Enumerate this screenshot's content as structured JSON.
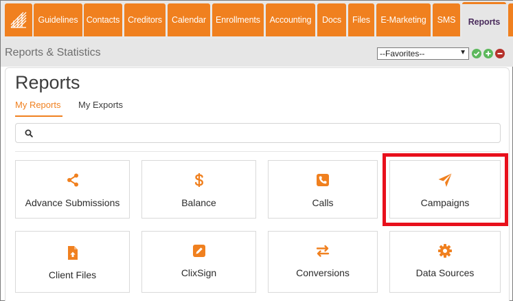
{
  "nav": {
    "tabs": [
      {
        "label": "Guidelines"
      },
      {
        "label": "Contacts"
      },
      {
        "label": "Creditors"
      },
      {
        "label": "Calendar"
      },
      {
        "label": "Enrollments"
      },
      {
        "label": "Accounting"
      },
      {
        "label": "Docs"
      },
      {
        "label": "Files"
      },
      {
        "label": "E-Marketing"
      },
      {
        "label": "SMS"
      },
      {
        "label": "Reports"
      }
    ],
    "active_tab": "Reports",
    "colors": {
      "tab": "#f0801f",
      "active_tab_text": "#4a2c5c"
    }
  },
  "subheader": {
    "title": "Reports & Statistics",
    "favorites": {
      "selected": "--Favorites--"
    },
    "buttons": [
      "check-icon",
      "plus-icon",
      "minus-icon"
    ]
  },
  "main": {
    "title": "Reports",
    "subtabs": [
      {
        "label": "My Reports",
        "active": true
      },
      {
        "label": "My Exports",
        "active": false
      }
    ],
    "search": {
      "placeholder": "",
      "value": ""
    },
    "tiles": [
      {
        "label": "Advance Submissions",
        "icon": "share-icon"
      },
      {
        "label": "Balance",
        "icon": "dollar-icon"
      },
      {
        "label": "Calls",
        "icon": "phone-icon"
      },
      {
        "label": "Campaigns",
        "icon": "paper-plane-icon",
        "highlighted": true
      },
      {
        "label": "Client Files",
        "icon": "file-upload-icon"
      },
      {
        "label": "ClixSign",
        "icon": "edit-icon"
      },
      {
        "label": "Conversions",
        "icon": "exchange-icon"
      },
      {
        "label": "Data Sources",
        "icon": "gear-icon"
      }
    ],
    "accent_color": "#f0801f",
    "highlight_color": "#e8101c"
  }
}
